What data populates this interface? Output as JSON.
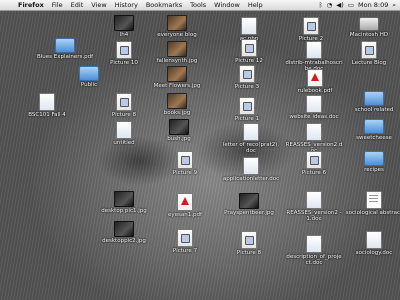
{
  "menubar": {
    "apple_glyph": "",
    "app_name": "Firefox",
    "items": [
      "File",
      "Edit",
      "View",
      "History",
      "Bookmarks",
      "Tools",
      "Window",
      "Help"
    ],
    "clock": "Mon 8:09"
  },
  "desktop": {
    "icons": [
      {
        "label": "lh4",
        "kind": "jpgdark"
      },
      {
        "label": "everyone blog",
        "kind": "jpg"
      },
      {
        "label": "ac.php",
        "kind": "doc"
      },
      {
        "label": "Picture 2",
        "kind": "pic"
      },
      {
        "label": "Macintosh HD",
        "kind": "disk"
      },
      {
        "label": "Blues Explainers.pdf",
        "kind": "folder"
      },
      {
        "label": "Picture 10",
        "kind": "pic"
      },
      {
        "label": "fallensynth.jpg",
        "kind": "jpg"
      },
      {
        "label": "Picture 12",
        "kind": "pic"
      },
      {
        "label": "distrib-mtrabalhoscribe.doc",
        "kind": "doc"
      },
      {
        "label": "Lecture Blog",
        "kind": "pic"
      },
      {
        "label": "Public",
        "kind": "folder"
      },
      {
        "label": "Meet Flowers.jpg",
        "kind": "jpg"
      },
      {
        "label": "Picture 3",
        "kind": "pic"
      },
      {
        "label": "rulebook.pdf",
        "kind": "pdf"
      },
      {
        "label": "BSC101 Fall 4",
        "kind": "doc"
      },
      {
        "label": "Picture 8",
        "kind": "pic"
      },
      {
        "label": "books.jpg",
        "kind": "jpg"
      },
      {
        "label": "Picture 1",
        "kind": "pic"
      },
      {
        "label": "website ideas.doc",
        "kind": "doc"
      },
      {
        "label": "school related",
        "kind": "folder"
      },
      {
        "label": "untitled",
        "kind": "doc"
      },
      {
        "label": "bush.jpg",
        "kind": "jpgdark"
      },
      {
        "label": "letter of reco(prat2).doc",
        "kind": "doc"
      },
      {
        "label": "REASSES_version2.doc",
        "kind": "doc"
      },
      {
        "label": "sweetcheese",
        "kind": "folder"
      },
      {
        "label": "recipes",
        "kind": "folder"
      },
      {
        "label": "Picture 9",
        "kind": "pic"
      },
      {
        "label": "applicationletter.doc",
        "kind": "doc"
      },
      {
        "label": "Picture 6",
        "kind": "pic"
      },
      {
        "label": "desktop pic1.jpg",
        "kind": "jpgdark"
      },
      {
        "label": "eyesan1.pdf",
        "kind": "pdf"
      },
      {
        "label": "Prayspentbeer.jpg",
        "kind": "jpgdark"
      },
      {
        "label": "REASSES_version2 - 1.doc",
        "kind": "doc"
      },
      {
        "label": "sociological abstract",
        "kind": "textfile"
      },
      {
        "label": "desktoppic2.jpg",
        "kind": "jpgdark"
      },
      {
        "label": "Picture 7",
        "kind": "pic"
      },
      {
        "label": "Picture 8",
        "kind": "pic"
      },
      {
        "label": "description_of_project.doc",
        "kind": "doc"
      },
      {
        "label": "sociology.doc",
        "kind": "doc"
      }
    ]
  }
}
